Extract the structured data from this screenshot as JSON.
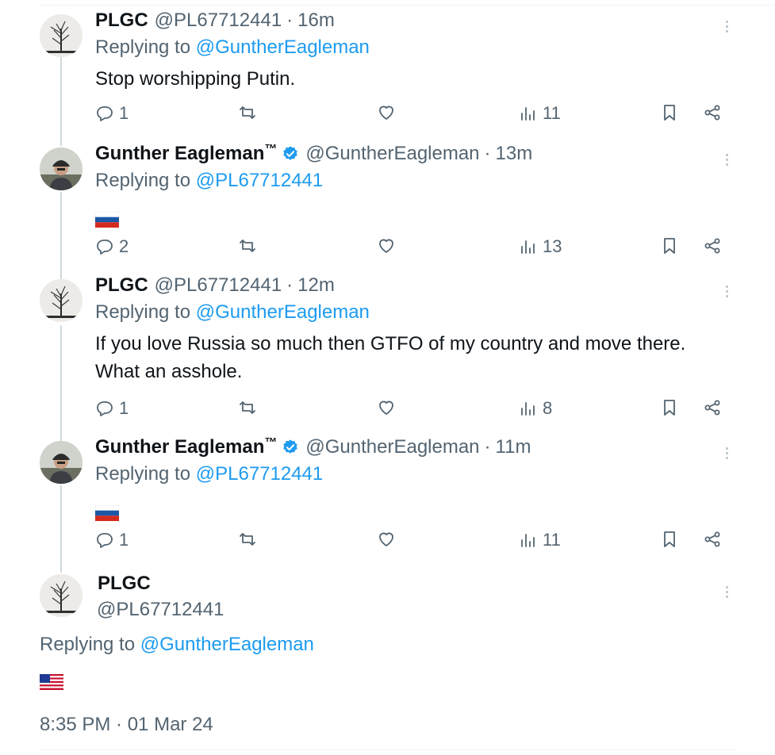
{
  "tweets": [
    {
      "name": "PLGC",
      "verified": false,
      "tm": "",
      "handle": "@PL67712441",
      "time": "16m",
      "replying_prefix": "Replying to ",
      "replying_to": "@GuntherEagleman",
      "text": "Stop worshipping Putin.",
      "flag": "",
      "replies": "1",
      "reposts": "",
      "likes": "",
      "views": "11"
    },
    {
      "name": "Gunther Eagleman",
      "verified": true,
      "tm": "™",
      "handle": "@GuntherEagleman",
      "time": "13m",
      "replying_prefix": "Replying to ",
      "replying_to": "@PL67712441",
      "text": "",
      "flag": "russia",
      "replies": "2",
      "reposts": "",
      "likes": "",
      "views": "13"
    },
    {
      "name": "PLGC",
      "verified": false,
      "tm": "",
      "handle": "@PL67712441",
      "time": "12m",
      "replying_prefix": "Replying to ",
      "replying_to": "@GuntherEagleman",
      "text": "If you love Russia so much then GTFO of my country and move there. What an asshole.",
      "flag": "",
      "replies": "1",
      "reposts": "",
      "likes": "",
      "views": "8"
    },
    {
      "name": "Gunther Eagleman",
      "verified": true,
      "tm": "™",
      "handle": "@GuntherEagleman",
      "time": "11m",
      "replying_prefix": "Replying to ",
      "replying_to": "@PL67712441",
      "text": "",
      "flag": "russia",
      "replies": "1",
      "reposts": "",
      "likes": "",
      "views": "11"
    }
  ],
  "separator": "·",
  "final_tweet": {
    "name": "PLGC",
    "handle": "@PL67712441",
    "replying_prefix": "Replying to ",
    "replying_to": "@GuntherEagleman",
    "flag": "usa",
    "timestamp": "8:35 PM · 01 Mar 24"
  },
  "icons": {
    "reply": "reply-icon",
    "repost": "repost-icon",
    "like": "heart-icon",
    "views": "views-icon",
    "bookmark": "bookmark-icon",
    "share": "share-icon",
    "verified": "verified-badge-icon",
    "more": "more-icon"
  },
  "colors": {
    "text": "#0f1419",
    "secondary": "#536471",
    "link": "#1d9bf0",
    "verified": "#1d9bf0",
    "thread_line": "#cfd9de"
  }
}
